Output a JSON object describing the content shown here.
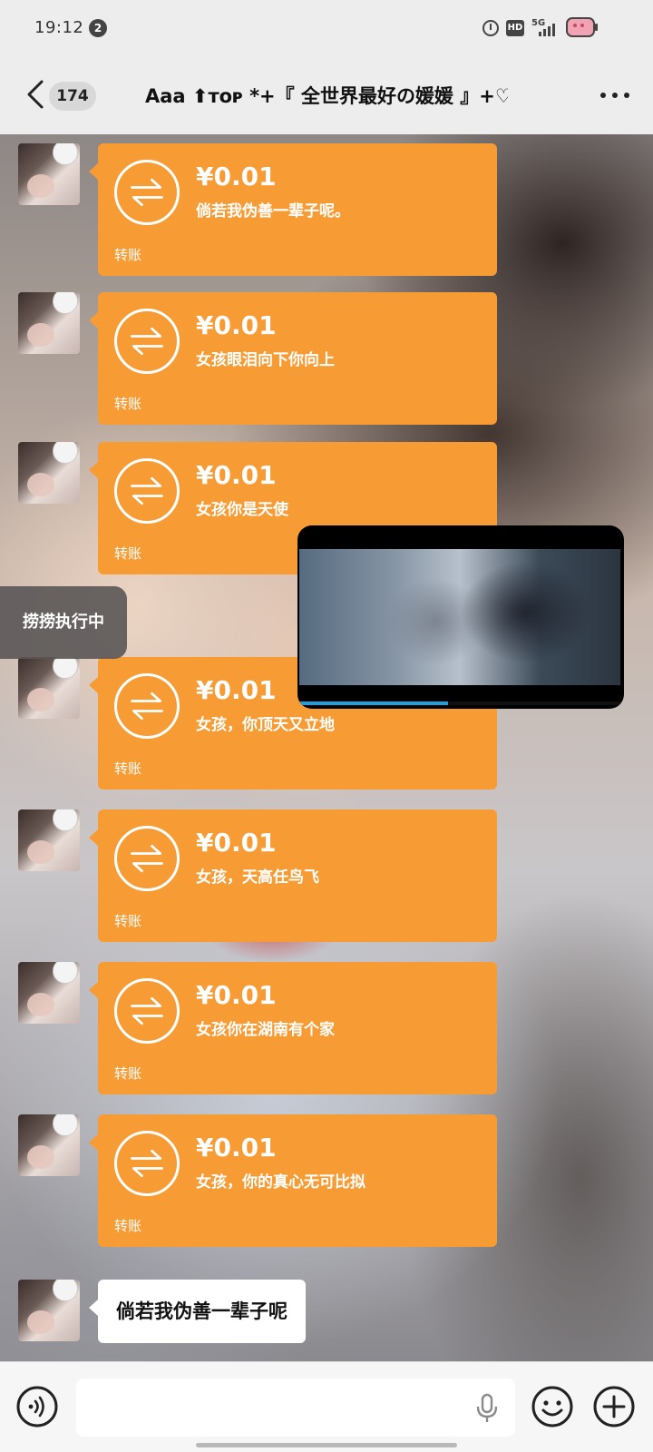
{
  "status_bar": {
    "time": "19:12",
    "notification_count": "2",
    "hd_label": "HD",
    "network_label": "5G"
  },
  "header": {
    "unread_count": "174",
    "title": "Aaa ⬆︎ᴛᴏᴘ *+『 全世界最好の媛媛 』+♡!!"
  },
  "messages": [
    {
      "type": "transfer",
      "amount": "¥0.01",
      "note": "倘若我伪善一辈子呢。",
      "label": "转账"
    },
    {
      "type": "transfer",
      "amount": "¥0.01",
      "note": "女孩眼泪向下你向上",
      "label": "转账"
    },
    {
      "type": "transfer",
      "amount": "¥0.01",
      "note": "女孩你是天使",
      "label": "转账"
    },
    {
      "type": "transfer",
      "amount": "¥0.01",
      "note": "女孩，你顶天又立地",
      "label": "转账"
    },
    {
      "type": "transfer",
      "amount": "¥0.01",
      "note": "女孩，天高任鸟飞",
      "label": "转账"
    },
    {
      "type": "transfer",
      "amount": "¥0.01",
      "note": "女孩你在湖南有个家",
      "label": "转账"
    },
    {
      "type": "transfer",
      "amount": "¥0.01",
      "note": "女孩，你的真心无可比拟",
      "label": "转账"
    },
    {
      "type": "text",
      "text": "倘若我伪善一辈子呢"
    }
  ],
  "floating_badge": "捞捞执行中",
  "video_overlay": {
    "progress": 0.46
  },
  "input_bar": {
    "placeholder": ""
  },
  "colors": {
    "transfer_bg": "#f79c35",
    "progress": "#1f9ee0"
  }
}
